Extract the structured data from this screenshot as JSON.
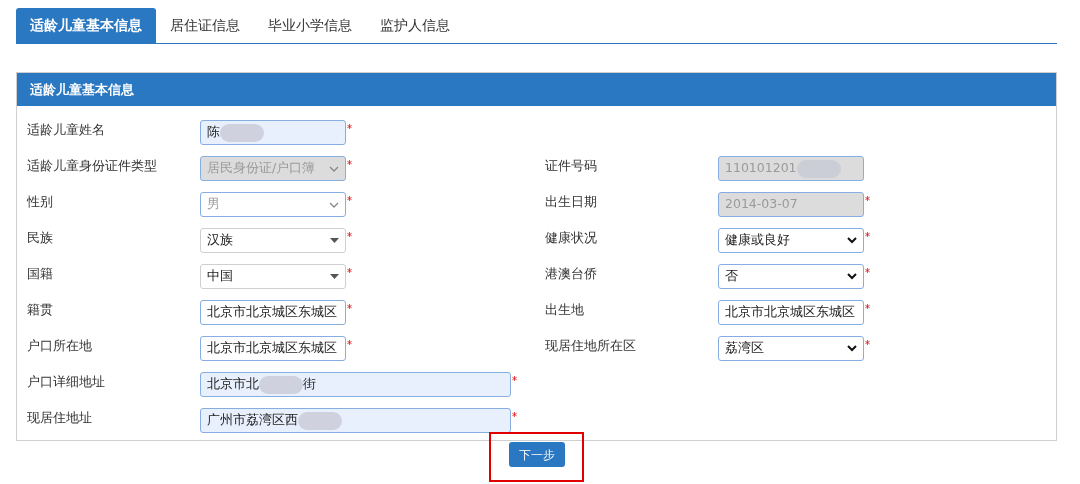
{
  "tabs": [
    {
      "label": "适龄儿童基本信息",
      "selected": true
    },
    {
      "label": "居住证信息",
      "selected": false
    },
    {
      "label": "毕业小学信息",
      "selected": false
    },
    {
      "label": "监护人信息",
      "selected": false
    }
  ],
  "panel": {
    "title": "适龄儿童基本信息",
    "rows": [
      {
        "left": {
          "label": "适龄儿童姓名",
          "kind": "text",
          "value": "陈",
          "redacted": true,
          "disabled": false,
          "autofill": true,
          "required": true
        }
      },
      {
        "left": {
          "label": "适龄儿童身份证件类型",
          "kind": "select",
          "value": "居民身份证/户口簿",
          "disabled": true,
          "required": true
        },
        "right": {
          "label": "证件号码",
          "kind": "text",
          "value": "110101201",
          "redacted": true,
          "disabled": true,
          "required": false
        }
      },
      {
        "left": {
          "label": "性别",
          "kind": "select",
          "value": "男",
          "disabled": false,
          "muted": true,
          "autofill": false,
          "required": true
        },
        "right": {
          "label": "出生日期",
          "kind": "text",
          "value": "2014-03-07",
          "disabled": true,
          "required": true
        }
      },
      {
        "left": {
          "label": "民族",
          "kind": "combo",
          "value": "汉族",
          "disabled": false,
          "autofill": false,
          "required": true
        },
        "right": {
          "label": "健康状况",
          "kind": "native",
          "value": "健康或良好",
          "disabled": false,
          "autofill": false,
          "required": true
        }
      },
      {
        "left": {
          "label": "国籍",
          "kind": "combo",
          "value": "中国",
          "disabled": false,
          "autofill": false,
          "required": true
        },
        "right": {
          "label": "港澳台侨",
          "kind": "native",
          "value": "否",
          "disabled": false,
          "autofill": false,
          "required": true
        }
      },
      {
        "left": {
          "label": "籍贯",
          "kind": "text",
          "value": "北京市北京城区东城区",
          "disabled": false,
          "autofill": false,
          "required": true
        },
        "right": {
          "label": "出生地",
          "kind": "text",
          "value": "北京市北京城区东城区",
          "disabled": false,
          "autofill": false,
          "required": true
        }
      },
      {
        "left": {
          "label": "户口所在地",
          "kind": "text",
          "value": "北京市北京城区东城区",
          "disabled": false,
          "autofill": false,
          "required": true
        },
        "right": {
          "label": "现居住地所在区",
          "kind": "native",
          "value": "荔湾区",
          "disabled": false,
          "autofill": false,
          "required": true
        }
      },
      {
        "left": {
          "label": "户口详细地址",
          "kind": "text",
          "wide": true,
          "value": "北京市北",
          "redacted": true,
          "suffix": "街",
          "disabled": false,
          "autofill": true,
          "required": true
        }
      },
      {
        "left": {
          "label": "现居住地址",
          "kind": "text",
          "wide": true,
          "value": "广州市荔湾区西",
          "redacted": true,
          "disabled": false,
          "autofill": true,
          "required": true
        }
      }
    ]
  },
  "next_button": {
    "label": "下一步",
    "highlighted": true
  }
}
